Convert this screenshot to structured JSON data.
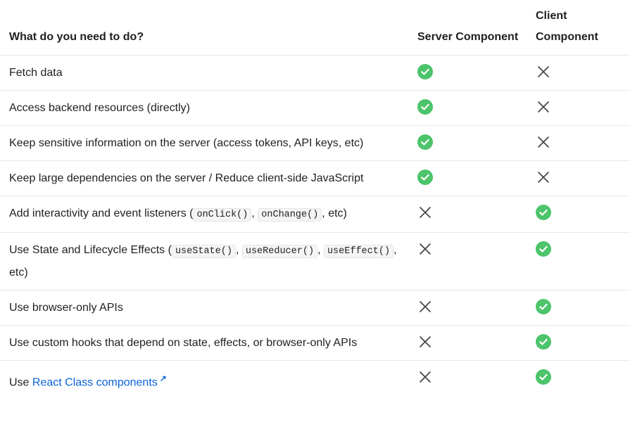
{
  "header": {
    "col1": "What do you need to do?",
    "col2": "Server Component",
    "col3": "Client Component"
  },
  "rows": [
    {
      "parts": [
        {
          "t": "text",
          "v": "Fetch data"
        }
      ],
      "server": true,
      "client": false
    },
    {
      "parts": [
        {
          "t": "text",
          "v": "Access backend resources (directly)"
        }
      ],
      "server": true,
      "client": false
    },
    {
      "parts": [
        {
          "t": "text",
          "v": "Keep sensitive information on the server (access tokens, API keys, etc)"
        }
      ],
      "server": true,
      "client": false
    },
    {
      "parts": [
        {
          "t": "text",
          "v": "Keep large dependencies on the server / Reduce client-side JavaScript"
        }
      ],
      "server": true,
      "client": false
    },
    {
      "parts": [
        {
          "t": "text",
          "v": "Add interactivity and event listeners ("
        },
        {
          "t": "code",
          "v": "onClick()"
        },
        {
          "t": "text",
          "v": ", "
        },
        {
          "t": "code",
          "v": "onChange()"
        },
        {
          "t": "text",
          "v": ", etc)"
        }
      ],
      "server": false,
      "client": true
    },
    {
      "parts": [
        {
          "t": "text",
          "v": "Use State and Lifecycle Effects ("
        },
        {
          "t": "code",
          "v": "useState()"
        },
        {
          "t": "text",
          "v": ", "
        },
        {
          "t": "code",
          "v": "useReducer()"
        },
        {
          "t": "text",
          "v": ", "
        },
        {
          "t": "code",
          "v": "useEffect()"
        },
        {
          "t": "text",
          "v": ", etc)"
        }
      ],
      "server": false,
      "client": true
    },
    {
      "parts": [
        {
          "t": "text",
          "v": "Use browser-only APIs"
        }
      ],
      "server": false,
      "client": true
    },
    {
      "parts": [
        {
          "t": "text",
          "v": "Use custom hooks that depend on state, effects, or browser-only APIs"
        }
      ],
      "server": false,
      "client": true
    },
    {
      "parts": [
        {
          "t": "text",
          "v": "Use "
        },
        {
          "t": "link",
          "v": "React Class components"
        }
      ],
      "server": false,
      "client": true
    }
  ],
  "colors": {
    "check": "#4cc46b",
    "cross": "#444444",
    "link": "#0a63d7"
  },
  "icons": {
    "yes": "check-circle-icon",
    "no": "x-icon",
    "external": "external-link-icon"
  }
}
